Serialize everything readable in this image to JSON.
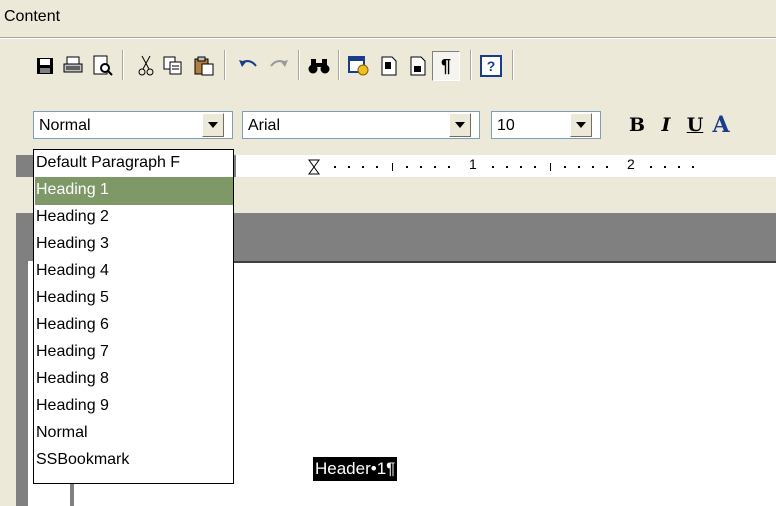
{
  "window": {
    "title": "Content"
  },
  "toolbar": {
    "buttons": [
      {
        "id": "save",
        "icon": "floppy-disk-icon"
      },
      {
        "id": "print",
        "icon": "printer-icon"
      },
      {
        "id": "print-preview",
        "icon": "print-preview-icon"
      },
      {
        "id": "cut",
        "icon": "scissors-icon"
      },
      {
        "id": "copy",
        "icon": "copy-icon"
      },
      {
        "id": "paste",
        "icon": "clipboard-icon"
      },
      {
        "id": "undo",
        "icon": "undo-arrow-icon"
      },
      {
        "id": "redo",
        "icon": "redo-arrow-icon"
      },
      {
        "id": "find",
        "icon": "binoculars-icon"
      },
      {
        "id": "insert-datetime",
        "icon": "calendar-clock-icon"
      },
      {
        "id": "header",
        "icon": "page-header-icon"
      },
      {
        "id": "footer",
        "icon": "page-footer-icon"
      },
      {
        "id": "show-formatting",
        "icon": "pilcrow-icon",
        "label": "¶"
      },
      {
        "id": "help",
        "icon": "help-icon",
        "label": "?"
      }
    ]
  },
  "formatting": {
    "style_value": "Normal",
    "font_value": "Arial",
    "size_value": "10",
    "bold_label": "B",
    "italic_label": "I",
    "underline_label": "U",
    "font_color_label": "A"
  },
  "ruler": {
    "numbers": [
      "1",
      "2"
    ]
  },
  "style_dropdown": {
    "options": [
      "Default Paragraph F",
      "Heading 1",
      "Heading 2",
      "Heading 3",
      "Heading 4",
      "Heading 5",
      "Heading 6",
      "Heading 7",
      "Heading 8",
      "Heading 9",
      "Normal",
      "SSBookmark"
    ],
    "selected": "Heading 1"
  },
  "document": {
    "selected_text": "Header•1¶"
  },
  "colors": {
    "selection": "#7e9867",
    "face": "#ece9d8",
    "gray": "#808080"
  }
}
